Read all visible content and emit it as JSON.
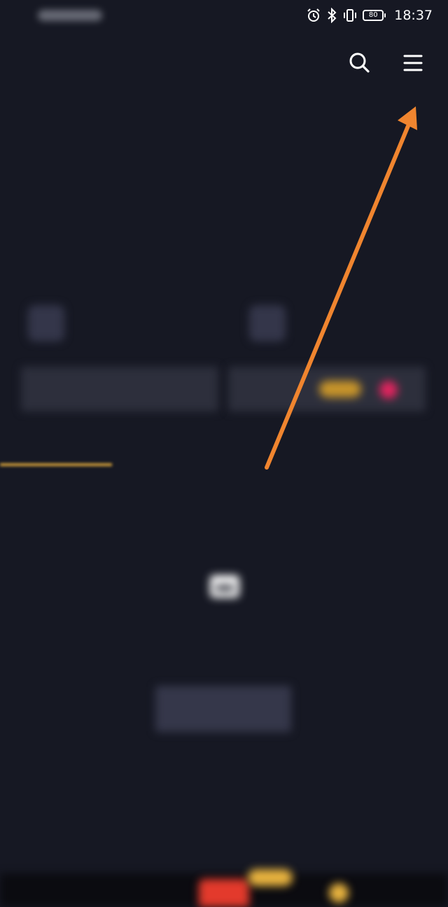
{
  "status_bar": {
    "carrier": "",
    "battery_level": "80",
    "time": "18:37",
    "icons": [
      "alarm-icon",
      "bluetooth-icon",
      "vibrate-icon",
      "battery-icon"
    ]
  },
  "header": {
    "search_icon": "search-icon",
    "menu_icon": "hamburger-menu-icon"
  },
  "profile": {
    "name": "",
    "id_line": "",
    "bio": ""
  },
  "features": [
    {
      "title": "",
      "subtitle": ""
    },
    {
      "title": "",
      "subtitle": ""
    }
  ],
  "actions": [
    {
      "label": ""
    },
    {
      "label": ""
    }
  ],
  "tabs": [
    {
      "label": ""
    },
    {
      "label": ""
    },
    {
      "label": ""
    },
    {
      "label": ""
    }
  ],
  "empty_state": {
    "message": "",
    "button_label": ""
  },
  "bottom_nav": {
    "items": [
      {
        "label": ""
      },
      {
        "label": ""
      },
      {
        "label": ""
      },
      {
        "label": ""
      },
      {
        "label": ""
      }
    ]
  },
  "annotation": {
    "color": "#f0852f",
    "target": "hamburger-menu-icon"
  },
  "colors": {
    "background": "#161823",
    "accent_gold": "#d7a33a",
    "accent_red": "#e33a2c"
  }
}
